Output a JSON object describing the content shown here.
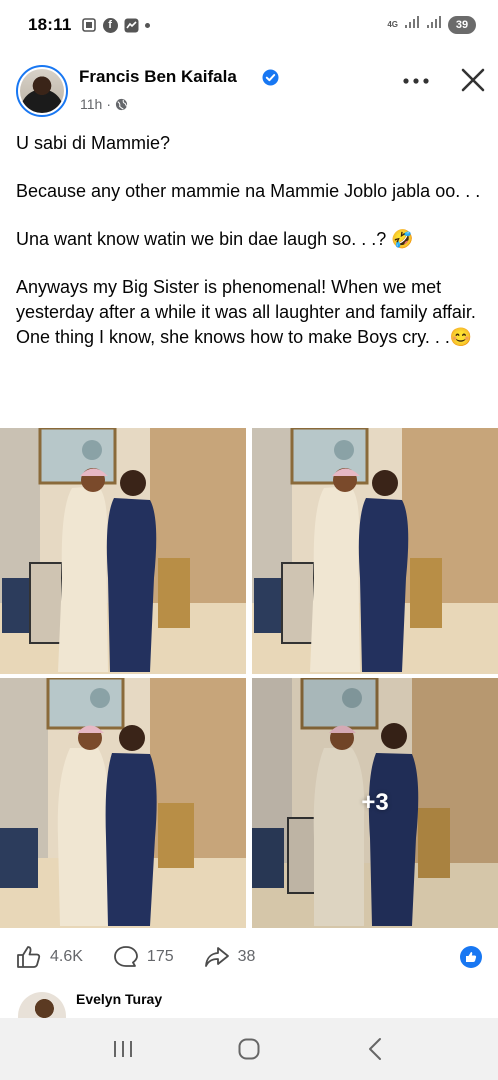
{
  "status_bar": {
    "time": "18:11",
    "network": "4G",
    "battery": "39"
  },
  "post": {
    "author": "Francis Ben Kaifala",
    "time": "11h",
    "separator": "·",
    "paragraphs": [
      "U sabi di Mammie?",
      "Because any other mammie na Mammie Joblo jabla oo. . .",
      "Una want know watin we bin dae laugh so. . .? 🤣",
      "Anyways my Big Sister is phenomenal! When we met yesterday after a while it was all laughter and family affair. One thing I know, she knows how to make Boys cry. . .😊"
    ],
    "more_photos_label": "+3",
    "reactions": {
      "likes": "4.6K",
      "comments": "175",
      "shares": "38"
    },
    "comment_preview_name": "Evelyn Turay"
  },
  "colors": {
    "brand": "#1877f2",
    "secondary_text": "#65676b"
  }
}
